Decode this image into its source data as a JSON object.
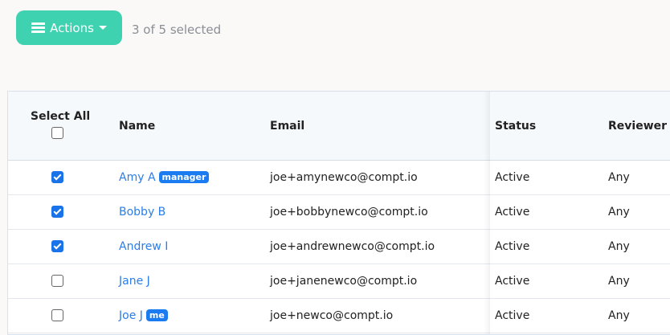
{
  "toolbar": {
    "actions_label": "Actions",
    "selection_text": "3 of 5 selected"
  },
  "table": {
    "headers": {
      "select_all": "Select All",
      "name": "Name",
      "email": "Email",
      "status": "Status",
      "reviewer": "Reviewer"
    },
    "rows": [
      {
        "checked": true,
        "name": "Amy A",
        "badge": "manager",
        "email": "joe+amynewco@compt.io",
        "status": "Active",
        "reviewer": "Any"
      },
      {
        "checked": true,
        "name": "Bobby B",
        "badge": "",
        "email": "joe+bobbynewco@compt.io",
        "status": "Active",
        "reviewer": "Any"
      },
      {
        "checked": true,
        "name": "Andrew I",
        "badge": "",
        "email": "joe+andrewnewco@compt.io",
        "status": "Active",
        "reviewer": "Any"
      },
      {
        "checked": false,
        "name": "Jane J",
        "badge": "",
        "email": "joe+janenewco@compt.io",
        "status": "Active",
        "reviewer": "Any"
      },
      {
        "checked": false,
        "name": "Joe J",
        "badge": "me",
        "email": "joe+newco@compt.io",
        "status": "Active",
        "reviewer": "Any"
      }
    ]
  }
}
